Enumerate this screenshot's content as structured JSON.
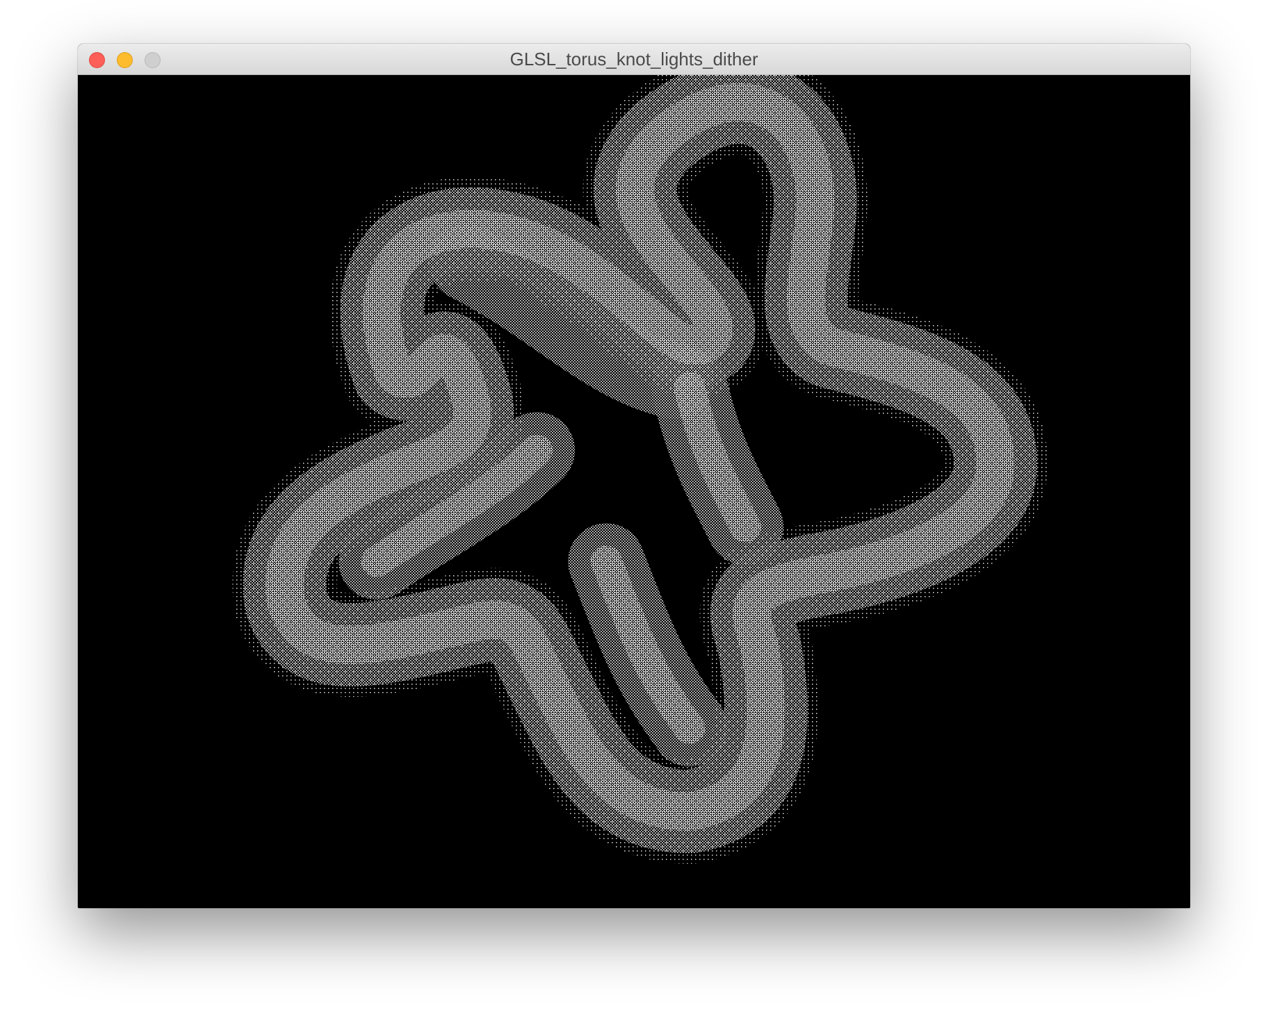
{
  "window": {
    "title": "GLSL_torus_knot_lights_dither",
    "controls": {
      "close": "close-icon",
      "minimize": "minimize-icon",
      "zoom": "zoom-icon"
    }
  },
  "scene": {
    "subject": "torus knot",
    "render_style": "ordered dither",
    "background_color": "#000000",
    "foreground_color": "#ffffff"
  }
}
